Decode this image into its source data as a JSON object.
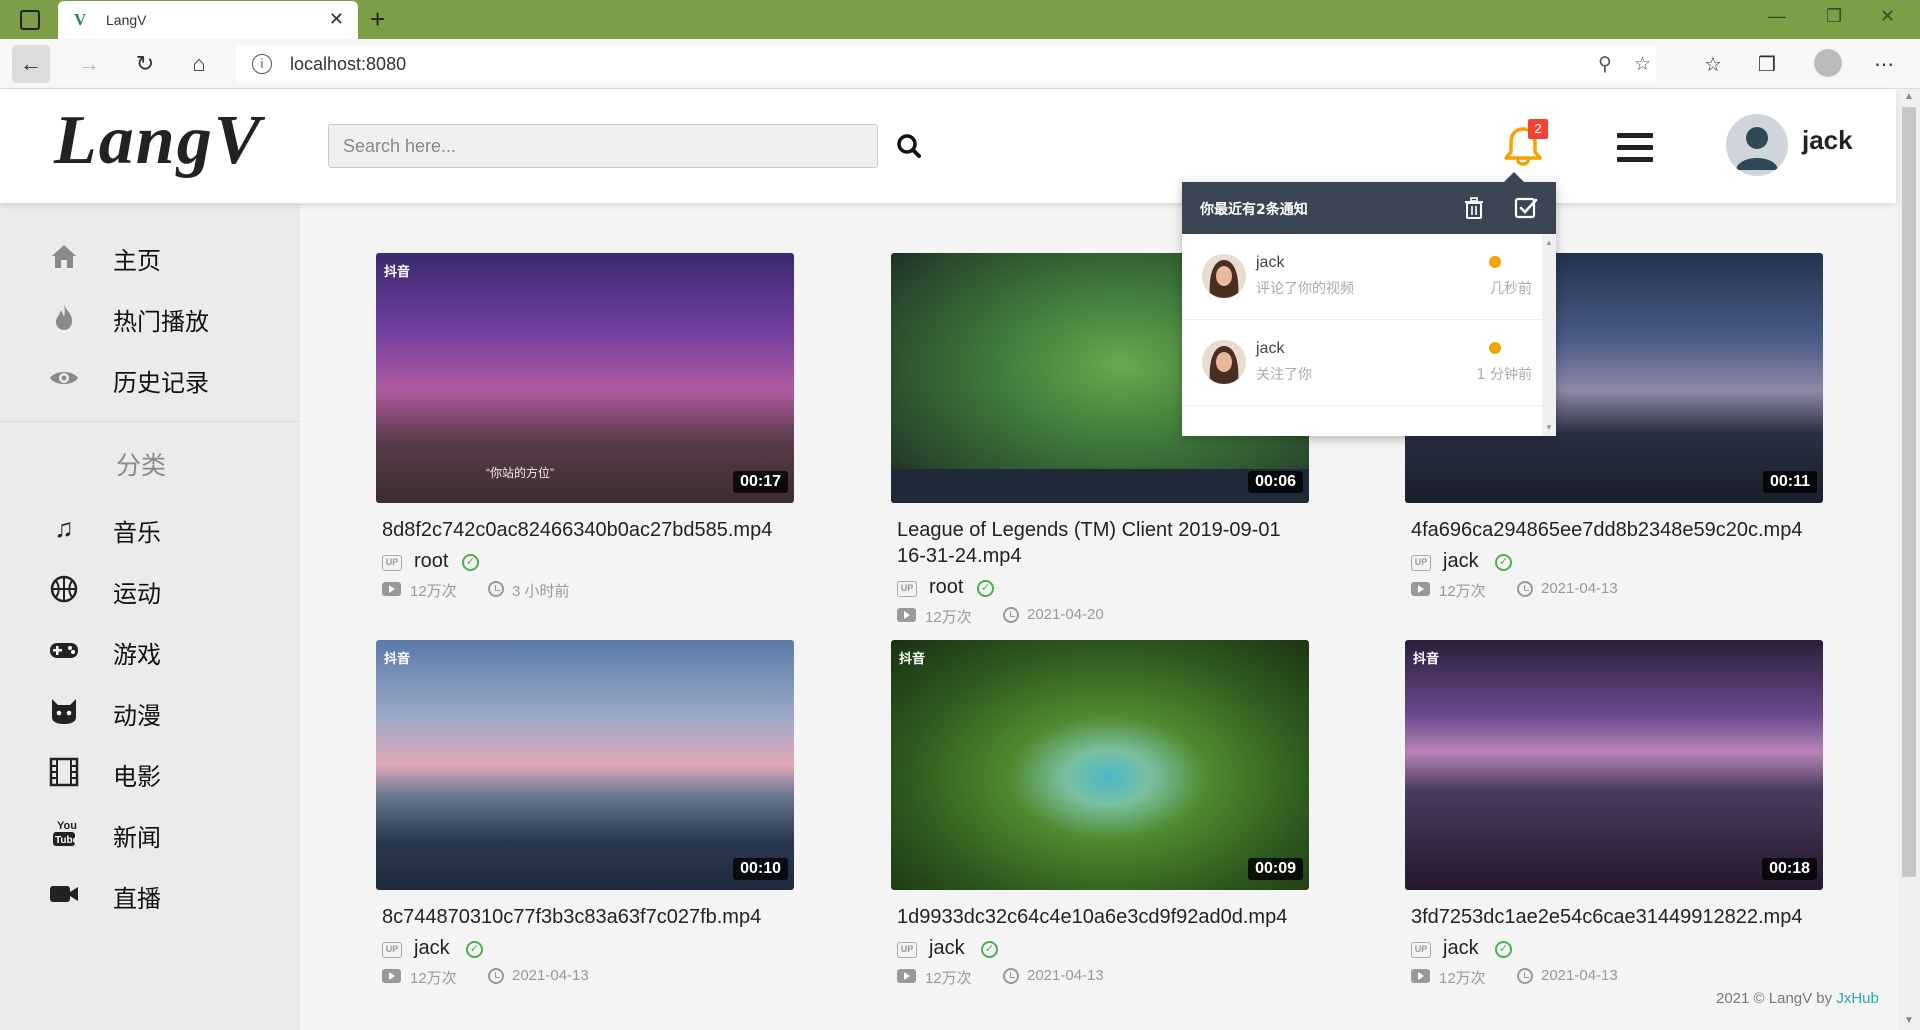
{
  "browser": {
    "tab_title": "LangV",
    "tab_favicon": "V",
    "url": "localhost:8080"
  },
  "header": {
    "logo": "LangV",
    "search_placeholder": "Search here...",
    "notification_count": "2",
    "user_name": "jack"
  },
  "sidebar": {
    "main_items": [
      {
        "label": "主页",
        "icon": "home-icon"
      },
      {
        "label": "热门播放",
        "icon": "fire-icon"
      },
      {
        "label": "历史记录",
        "icon": "eye-icon"
      }
    ],
    "category_heading": "分类",
    "categories": [
      {
        "label": "音乐",
        "icon": "music-icon"
      },
      {
        "label": "运动",
        "icon": "basketball-icon"
      },
      {
        "label": "游戏",
        "icon": "gamepad-icon"
      },
      {
        "label": "动漫",
        "icon": "cat-icon"
      },
      {
        "label": "电影",
        "icon": "film-icon"
      },
      {
        "label": "新闻",
        "icon": "youtube-icon"
      },
      {
        "label": "直播",
        "icon": "video-camera-icon"
      }
    ]
  },
  "notifications": {
    "title": "你最近有2条通知",
    "items": [
      {
        "name": "jack",
        "text": "评论了你的视频",
        "time": "几秒前"
      },
      {
        "name": "jack",
        "text": "关注了你",
        "time": "1 分钟前"
      }
    ]
  },
  "videos": [
    {
      "title": "8d8f2c742c0ac82466340b0ac27bd585.mp4",
      "duration": "00:17",
      "author": "root",
      "views": "12万次",
      "time": "3 小时前",
      "watermark": "抖音",
      "caption": "“你站的方位”"
    },
    {
      "title": "League of Legends (TM) Client 2019-09-01 16-31-24.mp4",
      "duration": "00:06",
      "author": "root",
      "views": "12万次",
      "time": "2021-04-20"
    },
    {
      "title": "4fa696ca294865ee7dd8b2348e59c20c.mp4",
      "duration": "00:11",
      "author": "jack",
      "views": "12万次",
      "time": "2021-04-13"
    },
    {
      "title": "8c744870310c77f3b3c83a63f7c027fb.mp4",
      "duration": "00:10",
      "author": "jack",
      "views": "12万次",
      "time": "2021-04-13",
      "watermark": "抖音"
    },
    {
      "title": "1d9933dc32c64c4e10a6e3cd9f92ad0d.mp4",
      "duration": "00:09",
      "author": "jack",
      "views": "12万次",
      "time": "2021-04-13",
      "watermark": "抖音"
    },
    {
      "title": "3fd7253dc1ae2e54c6cae31449912822.mp4",
      "duration": "00:18",
      "author": "jack",
      "views": "12万次",
      "time": "2021-04-13",
      "watermark": "抖音"
    }
  ],
  "footer": {
    "text": "2021 © LangV by ",
    "link": "JxHub"
  },
  "colors": {
    "tabbar": "#7c9e46",
    "notif_header": "#3b4554",
    "badge": "#f44336",
    "bell": "#f4a300",
    "verified": "#4caf50",
    "footer_link": "#2aa6b5"
  }
}
